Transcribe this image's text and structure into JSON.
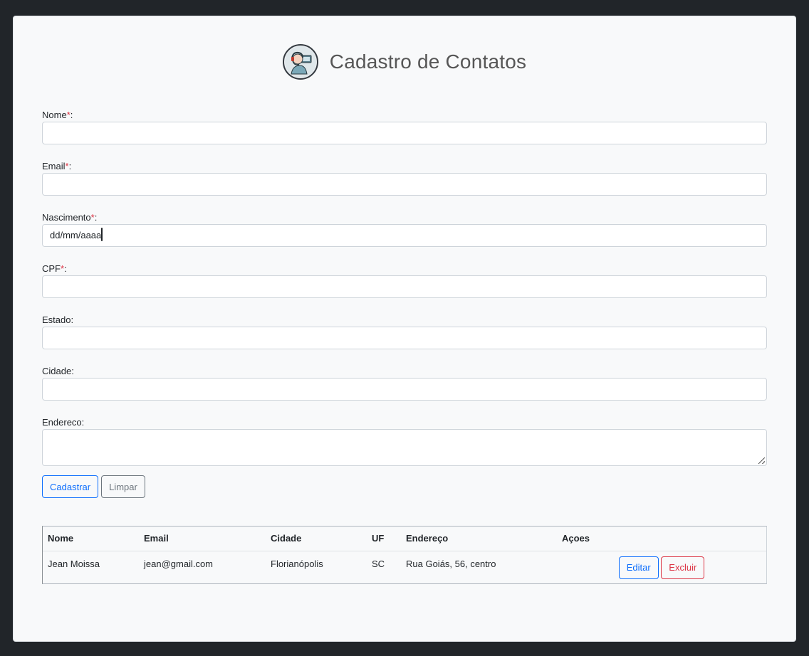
{
  "header": {
    "title": "Cadastro de Contatos"
  },
  "form": {
    "fields": [
      {
        "label": "Nome",
        "required_mark": "*",
        "suffix": ":",
        "value": ""
      },
      {
        "label": "Email",
        "required_mark": "*",
        "suffix": ":",
        "value": ""
      },
      {
        "label": "Nascimento",
        "required_mark": "*",
        "suffix": ":",
        "value": "dd/mm/aaaa"
      },
      {
        "label": "CPF",
        "required_mark": "*",
        "suffix": ":",
        "value": ""
      },
      {
        "label": "Estado",
        "required_mark": "",
        "suffix": ":",
        "value": ""
      },
      {
        "label": "Cidade",
        "required_mark": "",
        "suffix": ":",
        "value": ""
      },
      {
        "label": "Endereco",
        "required_mark": "",
        "suffix": ":",
        "value": ""
      }
    ],
    "buttons": {
      "submit": "Cadastrar",
      "clear": "Limpar"
    }
  },
  "table": {
    "headers": [
      "Nome",
      "Email",
      "Cidade",
      "UF",
      "Endereço",
      "Açoes"
    ],
    "rows": [
      {
        "nome": "Jean Moissa",
        "email": "jean@gmail.com",
        "cidade": "Florianópolis",
        "uf": "SC",
        "endereco": "Rua Goiás, 56, centro",
        "edit_label": "Editar",
        "delete_label": "Excluir"
      }
    ]
  },
  "colors": {
    "page_bg": "#212529",
    "card_bg": "#f8f9fa",
    "primary": "#0d6efd",
    "secondary": "#6c757d",
    "danger": "#dc3545"
  },
  "icons": {
    "logo": "headset-support-avatar",
    "date": "calendar-icon"
  }
}
